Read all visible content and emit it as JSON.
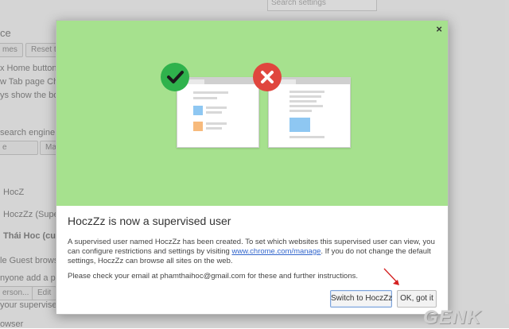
{
  "background": {
    "search_placeholder": "Search settings",
    "texts": [
      "ce",
      "x Home button",
      "w Tab page Change",
      "ys show the bookm",
      "search engine is u",
      "e",
      "Ma",
      "HocZ",
      "HoczZz (Supervise",
      "Thái Hoc (current)",
      "le Guest browsing",
      "nyone add a person",
      "erson...",
      "Edit",
      "your supervised use",
      "owser"
    ],
    "buttons": [
      "mes",
      "Reset to d"
    ]
  },
  "dialog": {
    "close_label": "×",
    "title": "HoczZz is now a supervised user",
    "para1_before": "A supervised user named HoczZz has been created. To set which websites this supervised user can view, you can configure restrictions and settings by visiting ",
    "para1_link": "www.chrome.com/manage",
    "para1_after": ". If you do not change the default settings, HoczZz can browse all sites on the web.",
    "para2": "Please check your email at phamthaihoc@gmail.com for these and further instructions.",
    "switch_button": "Switch to HoczZz",
    "ok_button": "OK, got it"
  },
  "colors": {
    "hero_green": "#a6e18e",
    "check_green": "#2fb24c",
    "error_red": "#e0463e",
    "link_blue": "#3366cc"
  },
  "icons": {
    "allowed": "check-icon",
    "blocked": "cross-icon",
    "close": "close-icon"
  },
  "watermark": "GENK"
}
